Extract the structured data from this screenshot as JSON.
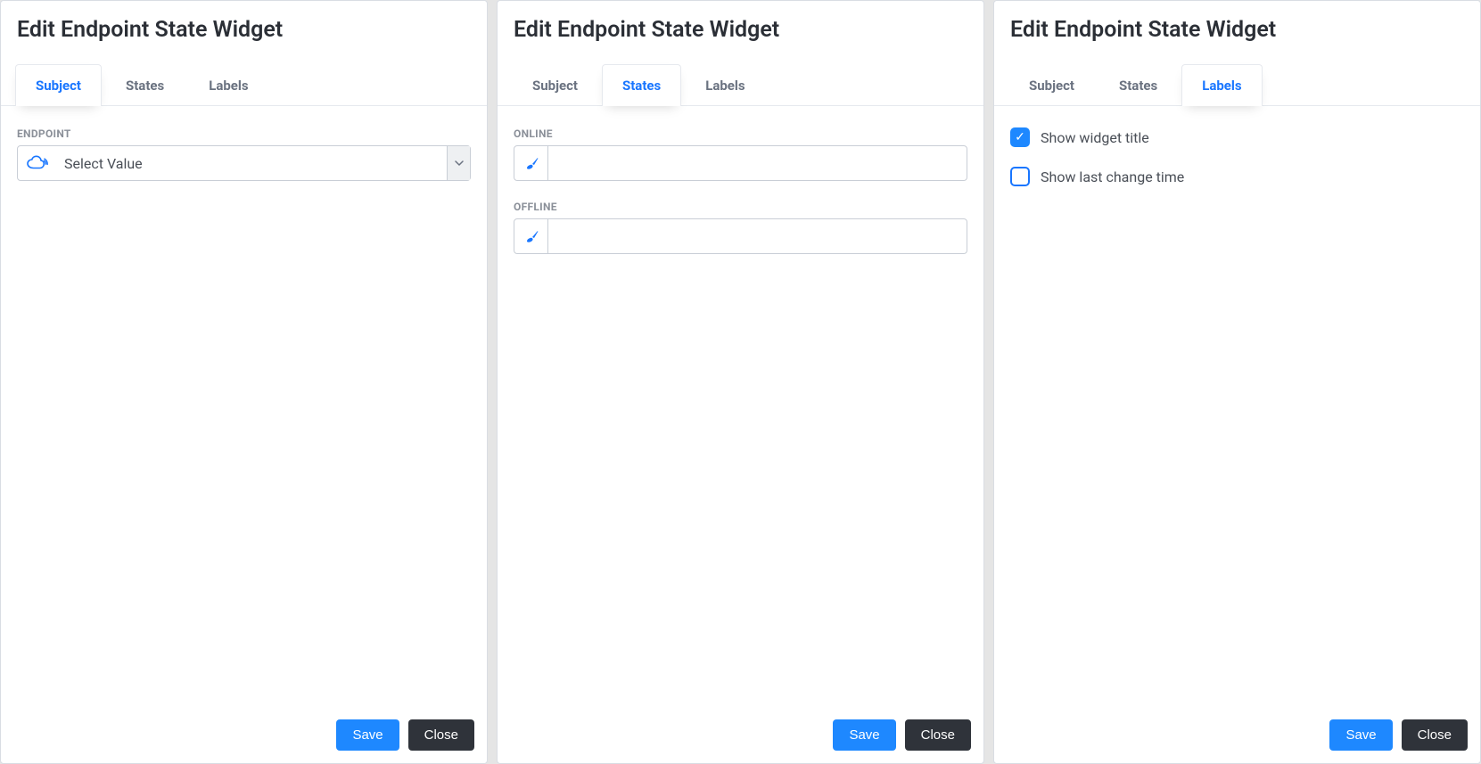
{
  "shared": {
    "title": "Edit Endpoint State Widget",
    "tabs": {
      "subject": "Subject",
      "states": "States",
      "labels": "Labels"
    },
    "buttons": {
      "save": "Save",
      "close": "Close"
    }
  },
  "panel1": {
    "activeTab": "subject",
    "endpoint_label": "ENDPOINT",
    "endpoint_value": "Select Value"
  },
  "panel2": {
    "activeTab": "states",
    "online_label": "ONLINE",
    "online_value": "",
    "offline_label": "OFFLINE",
    "offline_value": ""
  },
  "panel3": {
    "activeTab": "labels",
    "show_title_label": "Show widget title",
    "show_title_checked": true,
    "show_lastchange_label": "Show last change time",
    "show_lastchange_checked": false
  }
}
